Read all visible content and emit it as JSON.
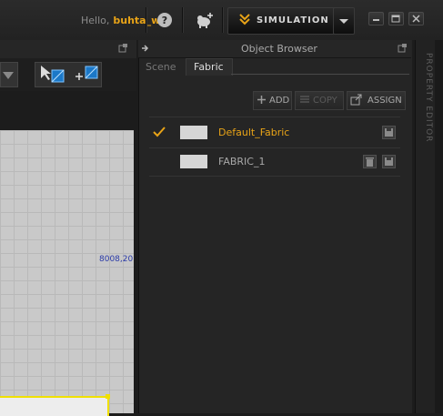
{
  "header": {
    "greeting": "Hello,",
    "username": "buhta_ws",
    "simulation_label": "SIMULATION"
  },
  "object_browser": {
    "title": "Object Browser",
    "tabs": [
      {
        "label": "Scene",
        "active": false
      },
      {
        "label": "Fabric",
        "active": true
      }
    ],
    "buttons": {
      "add": "ADD",
      "copy": "COPY",
      "assign": "ASSIGN"
    },
    "fabrics": [
      {
        "name": "Default_Fabric",
        "selected": true,
        "color": "#d6d6d6"
      },
      {
        "name": "FABRIC_1",
        "selected": false,
        "color": "#d6d6d6"
      }
    ]
  },
  "property_editor": {
    "label": "PROPERTY EDITOR"
  },
  "viewport_2d": {
    "coordinate_text": "8008,20"
  },
  "colors": {
    "accent": "#e8a317",
    "background": "#1c1c1c",
    "panel": "#252525",
    "selection_outline": "#f0e000",
    "coordinate_text": "#2a3aa8"
  }
}
